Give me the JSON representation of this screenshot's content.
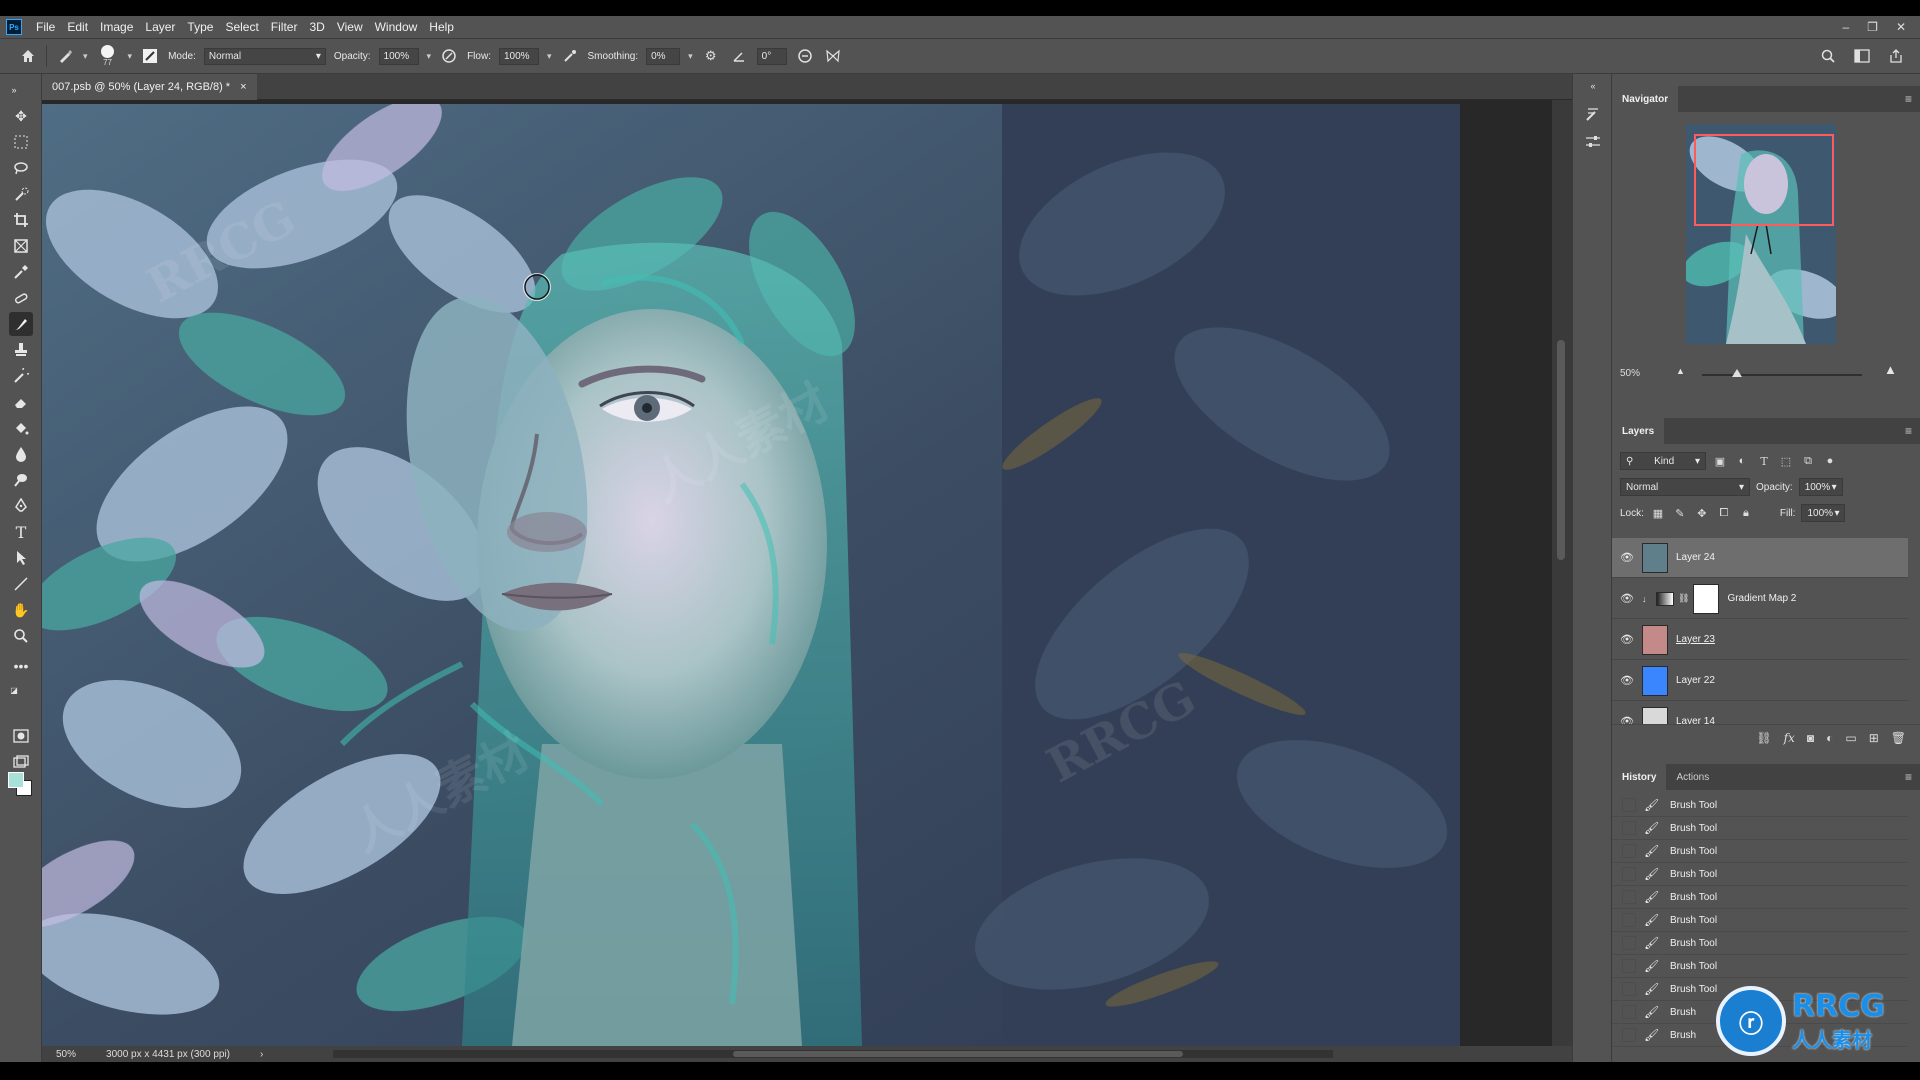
{
  "menubar": {
    "logo": "Ps",
    "items": [
      "File",
      "Edit",
      "Image",
      "Layer",
      "Type",
      "Select",
      "Filter",
      "3D",
      "View",
      "Window",
      "Help"
    ],
    "controls": [
      "–",
      "❐",
      "✕"
    ]
  },
  "options": {
    "brush_size": "77",
    "mode_label": "Mode:",
    "mode_value": "Normal",
    "opacity_label": "Opacity:",
    "opacity_value": "100%",
    "flow_label": "Flow:",
    "flow_value": "100%",
    "smoothing_label": "Smoothing:",
    "smoothing_value": "0%",
    "angle_value": "0°"
  },
  "document": {
    "tab_title": "007.psb @ 50% (Layer 24, RGB/8) *",
    "close": "×"
  },
  "status": {
    "zoom": "50%",
    "doc_info": "3000 px x 4431 px (300 ppi)",
    "arrow": "›"
  },
  "navigator": {
    "title": "Navigator",
    "zoom": "50%"
  },
  "layers": {
    "title": "Layers",
    "filter_kind": "Kind",
    "blend_mode": "Normal",
    "opacity_label": "Opacity:",
    "opacity_value": "100%",
    "lock_label": "Lock:",
    "fill_label": "Fill:",
    "fill_value": "100%",
    "items": [
      {
        "name": "Layer 24",
        "thumb_color": "#5f7f8a"
      },
      {
        "name": "Gradient Map 2",
        "thumb_color": "#ffffff"
      },
      {
        "name": "Layer 23",
        "thumb_color": "#c48a8a"
      },
      {
        "name": "Layer 22",
        "thumb_color": "#3a86ff"
      },
      {
        "name": "Layer 14",
        "thumb_color": "#d9d9d9"
      }
    ]
  },
  "history": {
    "tab_history": "History",
    "tab_actions": "Actions",
    "items": [
      "Brush Tool",
      "Brush Tool",
      "Brush Tool",
      "Brush Tool",
      "Brush Tool",
      "Brush Tool",
      "Brush Tool",
      "Brush Tool",
      "Brush Tool",
      "Brush",
      "Brush"
    ]
  },
  "watermark": {
    "brand": "RRCG",
    "sub": "人人素材",
    "corner": "RRCG"
  },
  "colors": {
    "foreground": "#a7e1d7",
    "background": "#ffffff",
    "nav_view_box": "#ff5b5b"
  }
}
